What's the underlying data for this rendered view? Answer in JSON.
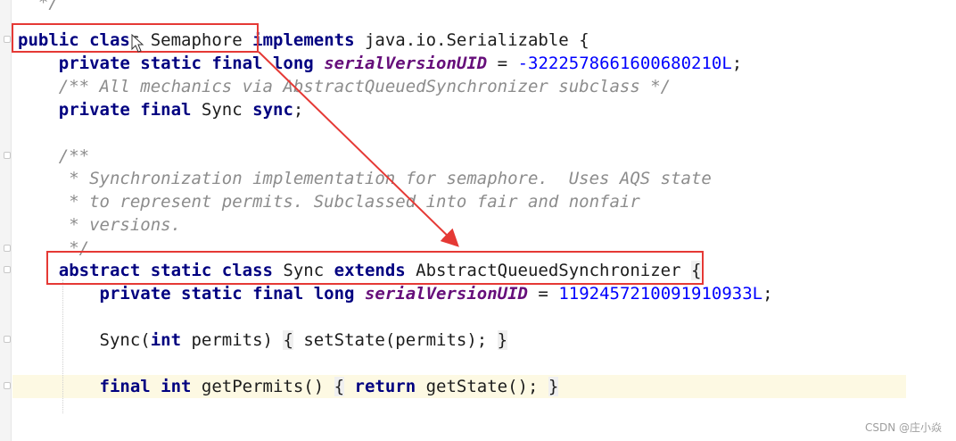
{
  "editor": {
    "lines": [
      {
        "tokens": [
          {
            "t": "text",
            "v": "  "
          },
          {
            "t": "cm",
            "v": "*/"
          }
        ]
      },
      {
        "tokens": [
          {
            "t": "kw",
            "v": "public"
          },
          {
            "t": "text",
            "v": " "
          },
          {
            "t": "kw",
            "v": "clas"
          },
          {
            "t": "text",
            "v": "s Semaphore "
          },
          {
            "t": "kw",
            "v": "implements"
          },
          {
            "t": "text",
            "v": " java.io.Serializable {"
          }
        ]
      },
      {
        "tokens": [
          {
            "t": "text",
            "v": "    "
          },
          {
            "t": "kw",
            "v": "private static final long"
          },
          {
            "t": "text",
            "v": " "
          },
          {
            "t": "it",
            "v": "serialVersionUID"
          },
          {
            "t": "text",
            "v": " = "
          },
          {
            "t": "num",
            "v": "-3222578661600680210L"
          },
          {
            "t": "text",
            "v": ";"
          }
        ]
      },
      {
        "tokens": [
          {
            "t": "text",
            "v": "    "
          },
          {
            "t": "cm",
            "v": "/** All mechanics via AbstractQueuedSynchronizer subclass */"
          }
        ]
      },
      {
        "tokens": [
          {
            "t": "text",
            "v": "    "
          },
          {
            "t": "kw",
            "v": "private final"
          },
          {
            "t": "text",
            "v": " Sync "
          },
          {
            "t": "kw",
            "v": "sync"
          },
          {
            "t": "text",
            "v": ";"
          }
        ]
      },
      {
        "tokens": []
      },
      {
        "tokens": [
          {
            "t": "text",
            "v": "    "
          },
          {
            "t": "cm",
            "v": "/**"
          }
        ]
      },
      {
        "tokens": [
          {
            "t": "text",
            "v": "     "
          },
          {
            "t": "cm",
            "v": "* Synchronization implementation for semaphore.  Uses AQS state"
          }
        ]
      },
      {
        "tokens": [
          {
            "t": "text",
            "v": "     "
          },
          {
            "t": "cm",
            "v": "* to represent permits. Subclassed into fair and nonfair"
          }
        ]
      },
      {
        "tokens": [
          {
            "t": "text",
            "v": "     "
          },
          {
            "t": "cm",
            "v": "* versions."
          }
        ]
      },
      {
        "tokens": [
          {
            "t": "text",
            "v": "     "
          },
          {
            "t": "cm",
            "v": "*/"
          }
        ]
      },
      {
        "tokens": [
          {
            "t": "text",
            "v": "    "
          },
          {
            "t": "kw",
            "v": "abstract static class"
          },
          {
            "t": "text",
            "v": " Sync "
          },
          {
            "t": "kw",
            "v": "extends"
          },
          {
            "t": "text",
            "v": " AbstractQueuedSynchronizer "
          },
          {
            "t": "br",
            "v": "{"
          }
        ]
      },
      {
        "tokens": [
          {
            "t": "text",
            "v": "        "
          },
          {
            "t": "kw",
            "v": "private static final long"
          },
          {
            "t": "text",
            "v": " "
          },
          {
            "t": "it",
            "v": "serialVersionUID"
          },
          {
            "t": "text",
            "v": " = "
          },
          {
            "t": "num",
            "v": "1192457210091910933L"
          },
          {
            "t": "text",
            "v": ";"
          }
        ]
      },
      {
        "tokens": []
      },
      {
        "tokens": [
          {
            "t": "text",
            "v": "        Sync("
          },
          {
            "t": "kw",
            "v": "int"
          },
          {
            "t": "text",
            "v": " permits) "
          },
          {
            "t": "br",
            "v": "{"
          },
          {
            "t": "text",
            "v": " setState(permits); "
          },
          {
            "t": "br",
            "v": "}"
          }
        ]
      },
      {
        "tokens": []
      },
      {
        "tokens": [
          {
            "t": "text",
            "v": "        "
          },
          {
            "t": "kw",
            "v": "final int"
          },
          {
            "t": "text",
            "v": " getPermits() "
          },
          {
            "t": "br",
            "v": "{"
          },
          {
            "t": "text",
            "v": " "
          },
          {
            "t": "kw",
            "v": "return"
          },
          {
            "t": "text",
            "v": " getState(); "
          },
          {
            "t": "br",
            "v": "}"
          }
        ]
      }
    ]
  },
  "annotation": {
    "box_color": "#e53935",
    "arrow_color": "#e53935"
  },
  "watermark": "CSDN @庄小焱"
}
